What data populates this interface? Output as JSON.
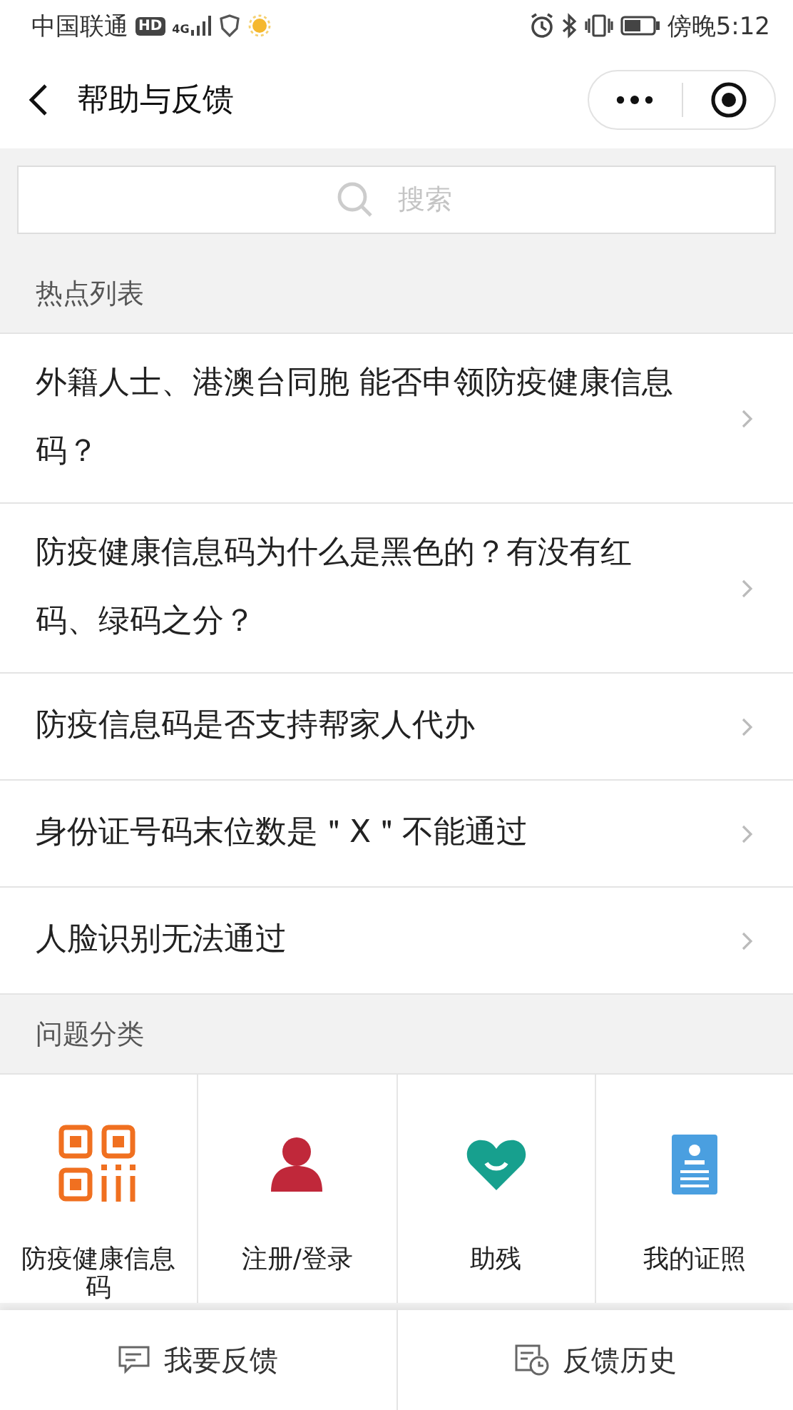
{
  "status_bar": {
    "carrier": "中国联通",
    "hd_badge": "HD",
    "network": "4G",
    "time": "傍晚5:12"
  },
  "nav": {
    "title": "帮助与反馈"
  },
  "search": {
    "placeholder": "搜索"
  },
  "hot": {
    "heading": "热点列表",
    "items": [
      {
        "text": "外籍人士、港澳台同胞 能否申领防疫健康信息码？"
      },
      {
        "text": "防疫健康信息码为什么是黑色的？有没有红码、绿码之分？"
      },
      {
        "text": "防疫信息码是否支持帮家人代办"
      },
      {
        "text": "身份证号码末位数是＂X＂不能通过"
      },
      {
        "text": "人脸识别无法通过"
      }
    ]
  },
  "categories": {
    "heading": "问题分类",
    "items": [
      {
        "label": "防疫健康信息码",
        "kind": "qr",
        "color": "#f07020"
      },
      {
        "label": "注册/登录",
        "kind": "person",
        "color": "#c0283a"
      },
      {
        "label": "助残",
        "kind": "heart",
        "color": "#17a08e"
      },
      {
        "label": "我的证照",
        "kind": "card",
        "color": "#4a9fe0"
      }
    ]
  },
  "bottom_bar": [
    {
      "label": "我要反馈",
      "kind": "feedback"
    },
    {
      "label": "反馈历史",
      "kind": "history"
    }
  ]
}
